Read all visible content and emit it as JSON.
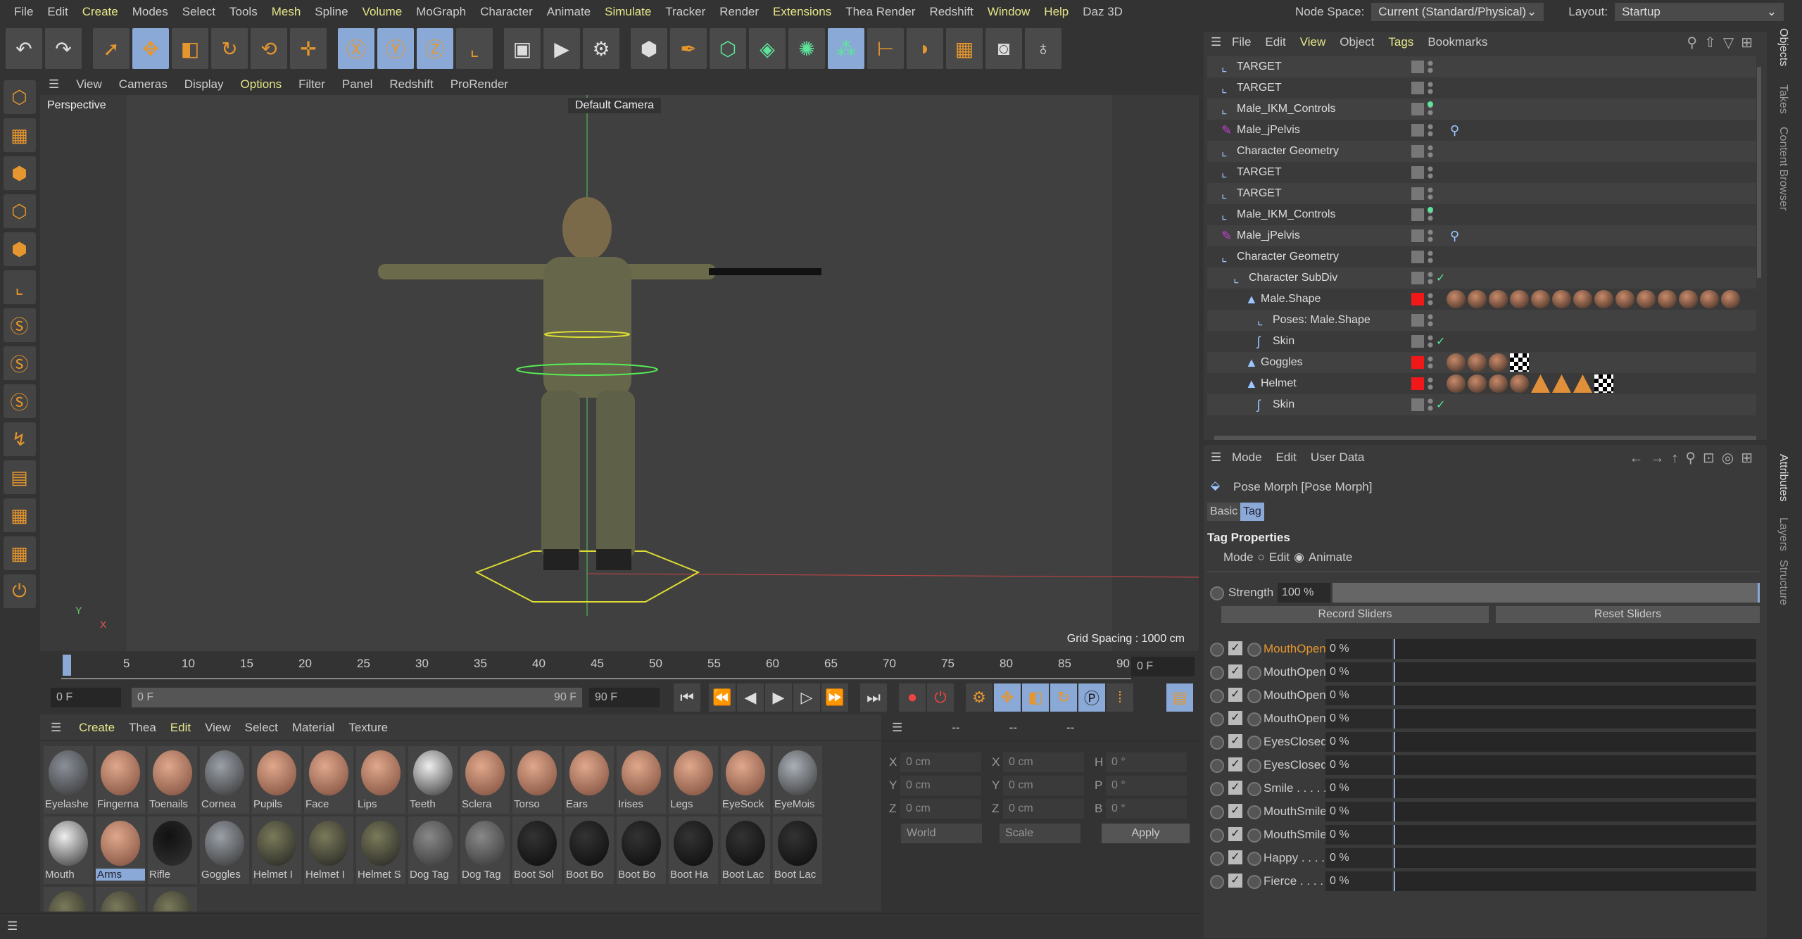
{
  "menu": [
    "File",
    "Edit",
    "Create",
    "Modes",
    "Select",
    "Tools",
    "Mesh",
    "Spline",
    "Volume",
    "MoGraph",
    "Character",
    "Animate",
    "Simulate",
    "Tracker",
    "Render",
    "Extensions",
    "Thea Render",
    "Redshift",
    "Window",
    "Help",
    "Daz 3D"
  ],
  "menu_highlight": [
    "Create",
    "Mesh",
    "Volume",
    "Simulate",
    "Extensions",
    "Window",
    "Help"
  ],
  "toolbar": [
    "undo",
    "redo",
    "select",
    "move",
    "scale",
    "rotate",
    "psr",
    "add",
    "X",
    "Y",
    "Z",
    "coord",
    "render-view",
    "render",
    "render-settings",
    "cube",
    "pen",
    "subdiv",
    "extrude",
    "mograph",
    "volume",
    "deformer",
    "floor",
    "scene",
    "camera",
    "light"
  ],
  "node_space": {
    "label": "Node Space:",
    "value": "Current (Standard/Physical)"
  },
  "layout": {
    "label": "Layout:",
    "value": "Startup"
  },
  "viewport": {
    "menu": [
      "View",
      "Cameras",
      "Display",
      "Options",
      "Filter",
      "Panel",
      "Redshift",
      "ProRender"
    ],
    "name": "Perspective",
    "camera": "Default Camera",
    "grid": "Grid Spacing : 1000 cm",
    "axis_y": "Y",
    "axis_x": "X"
  },
  "timeline": {
    "ticks": [
      "0",
      "5",
      "10",
      "15",
      "20",
      "25",
      "30",
      "35",
      "40",
      "45",
      "50",
      "55",
      "60",
      "65",
      "70",
      "75",
      "80",
      "85",
      "90"
    ],
    "current": "0 F",
    "start": "0 F",
    "range_start": "0 F",
    "range_end": "90 F",
    "end": "90 F"
  },
  "materials": {
    "menu": [
      "Create",
      "Thea",
      "Edit",
      "View",
      "Select",
      "Material",
      "Texture"
    ],
    "items": [
      "Eyelashe",
      "Fingerna",
      "Toenails",
      "Cornea",
      "Pupils",
      "Face",
      "Lips",
      "Teeth",
      "Sclera",
      "Torso",
      "Ears",
      "Irises",
      "Legs",
      "EyeSock",
      "EyeMois",
      "Mouth",
      "Arms",
      "Rifle",
      "Goggles",
      "Helmet I",
      "Helmet I",
      "Helmet S",
      "Dog Tag",
      "Dog Tag",
      "Boot Sol",
      "Boot Bo",
      "Boot Bo",
      "Boot Ha",
      "Boot Lac",
      "Boot Lac",
      "",
      "",
      ""
    ],
    "selected": "Arms"
  },
  "coords": {
    "header": [
      "--",
      "--",
      "--"
    ],
    "rows": [
      [
        "X",
        "0 cm",
        "X",
        "0 cm",
        "H",
        "0 °"
      ],
      [
        "Y",
        "0 cm",
        "Y",
        "0 cm",
        "P",
        "0 °"
      ],
      [
        "Z",
        "0 cm",
        "Z",
        "0 cm",
        "B",
        "0 °"
      ]
    ],
    "world": "World",
    "scale": "Scale",
    "apply": "Apply"
  },
  "objects": {
    "menu": [
      "File",
      "Edit",
      "View",
      "Object",
      "Tags",
      "Bookmarks"
    ],
    "rows": [
      {
        "name": "TARGET",
        "depth": 0,
        "red": false
      },
      {
        "name": "TARGET",
        "depth": 0,
        "red": false
      },
      {
        "name": "Male_IKM_Controls",
        "depth": 0,
        "red": false
      },
      {
        "name": "Male_jPelvis",
        "depth": 0,
        "red": false
      },
      {
        "name": "Character Geometry",
        "depth": 0,
        "red": false
      },
      {
        "name": "TARGET",
        "depth": 0,
        "red": false
      },
      {
        "name": "TARGET",
        "depth": 0,
        "red": false
      },
      {
        "name": "Male_IKM_Controls",
        "depth": 0,
        "red": false
      },
      {
        "name": "Male_jPelvis",
        "depth": 0,
        "red": false
      },
      {
        "name": "Character Geometry",
        "depth": 0,
        "red": false
      },
      {
        "name": "Character SubDiv",
        "depth": 1,
        "red": false
      },
      {
        "name": "Male.Shape",
        "depth": 2,
        "red": true
      },
      {
        "name": "Poses: Male.Shape",
        "depth": 3,
        "red": false
      },
      {
        "name": "Skin",
        "depth": 3,
        "red": false
      },
      {
        "name": "Goggles",
        "depth": 2,
        "red": true
      },
      {
        "name": "Helmet",
        "depth": 2,
        "red": true
      },
      {
        "name": "Skin",
        "depth": 3,
        "red": false
      }
    ]
  },
  "attributes": {
    "menu": [
      "Mode",
      "Edit",
      "User Data"
    ],
    "title": "Pose Morph [Pose Morph]",
    "tabs": [
      "Basic",
      "Tag"
    ],
    "section": "Tag Properties",
    "mode_label": "Mode",
    "mode_options": [
      "Edit",
      "Animate"
    ],
    "mode_selected": "Animate",
    "strength_label": "Strength",
    "strength": "100 %",
    "record": "Record Sliders",
    "reset": "Reset Sliders",
    "morphs": [
      {
        "name": "MouthOpenWide",
        "value": "0 %",
        "active": true
      },
      {
        "name": "MouthOpen . .",
        "value": "0 %"
      },
      {
        "name": "MouthOpenWide",
        "value": "0 %"
      },
      {
        "name": "MouthOpen . .",
        "value": "0 %"
      },
      {
        "name": "EyesClosedR . .",
        "value": "0 %"
      },
      {
        "name": "EyesClosedL . .",
        "value": "0 %"
      },
      {
        "name": "Smile . . . . . .",
        "value": "0 %"
      },
      {
        "name": "MouthSmileOpen",
        "value": "0 %"
      },
      {
        "name": "MouthSmile. . .",
        "value": "0 %"
      },
      {
        "name": "Happy . . . . .",
        "value": "0 %"
      },
      {
        "name": "Fierce . . . . . .",
        "value": "0 %"
      }
    ]
  },
  "side_tabs": [
    "Objects",
    "Takes",
    "Content Browser",
    "Attributes",
    "Layers",
    "Structure"
  ]
}
